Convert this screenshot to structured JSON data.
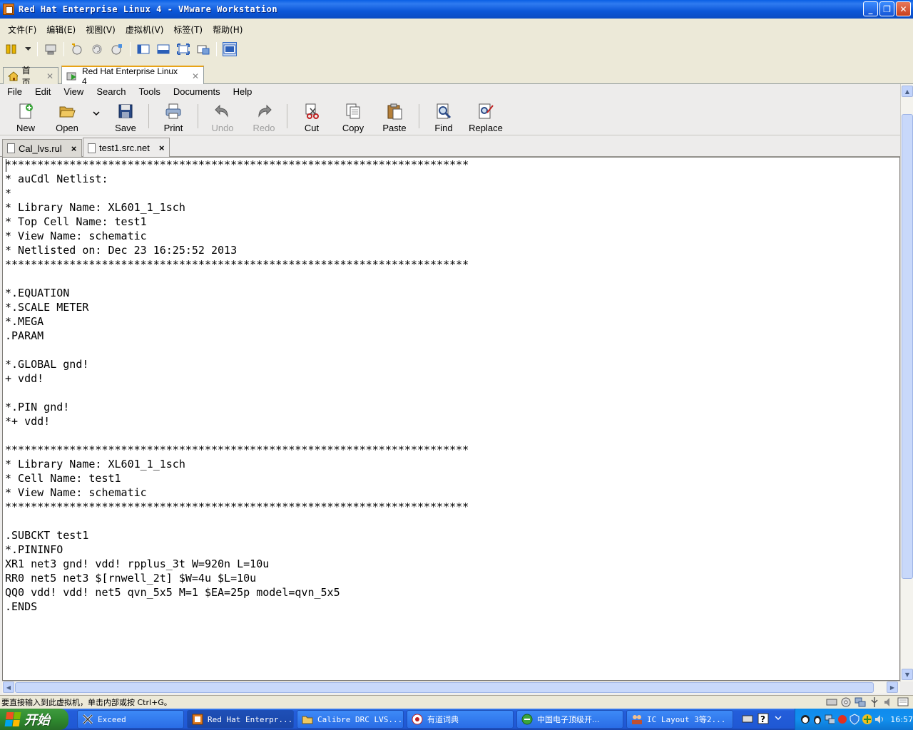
{
  "window": {
    "title": "Red Hat Enterprise Linux 4 - VMware Workstation",
    "min_label": "_",
    "max_label": "❐",
    "close_label": "✕"
  },
  "vm_menu": [
    "文件(F)",
    "编辑(E)",
    "视图(V)",
    "虚拟机(V)",
    "标签(T)",
    "帮助(H)"
  ],
  "vm_tabs": [
    {
      "label": "首页",
      "close": "✕"
    },
    {
      "label": "Red Hat Enterprise Linux 4",
      "close": "✕"
    }
  ],
  "gedit": {
    "menu": [
      "File",
      "Edit",
      "View",
      "Search",
      "Tools",
      "Documents",
      "Help"
    ],
    "toolbar": {
      "new": "New",
      "open": "Open",
      "save": "Save",
      "print": "Print",
      "undo": "Undo",
      "redo": "Redo",
      "cut": "Cut",
      "copy": "Copy",
      "paste": "Paste",
      "find": "Find",
      "replace": "Replace"
    },
    "tabs": [
      {
        "label": "Cal_lvs.rul",
        "close": "×"
      },
      {
        "label": "test1.src.net",
        "close": "×"
      }
    ],
    "content": "************************************************************************\n* auCdl Netlist:\n*\n* Library Name: XL601_1_1sch\n* Top Cell Name: test1\n* View Name: schematic\n* Netlisted on: Dec 23 16:25:52 2013\n************************************************************************\n\n*.EQUATION\n*.SCALE METER\n*.MEGA\n.PARAM\n\n*.GLOBAL gnd!\n+ vdd!\n\n*.PIN gnd!\n*+ vdd!\n\n************************************************************************\n* Library Name: XL601_1_1sch\n* Cell Name: test1\n* View Name: schematic\n************************************************************************\n\n.SUBCKT test1\n*.PININFO\nXR1 net3 gnd! vdd! rpplus_3t W=920n L=10u\nRR0 net5 net3 $[rnwell_2t] $W=4u $L=10u\nQQ0 vdd! vdd! net5 qvn_5x5 M=1 $EA=25p model=qvn_5x5\n.ENDS"
  },
  "vm_status": "要直接输入到此虚拟机，单击内部或按 Ctrl+G。",
  "taskbar": {
    "start": "开始",
    "tasks": [
      {
        "label": "Exceed"
      },
      {
        "label": "Red Hat Enterpr..."
      },
      {
        "label": "Calibre DRC LVS..."
      },
      {
        "label": "有道词典"
      },
      {
        "label": "中国电子顶级开..."
      },
      {
        "label": "IC Layout 3等2..."
      }
    ],
    "clock": "16:57"
  },
  "colors": {
    "titlebar": "#0a56d8",
    "taskbar": "#245edb",
    "start": "#2f8a2f",
    "tray": "#1290ee"
  }
}
